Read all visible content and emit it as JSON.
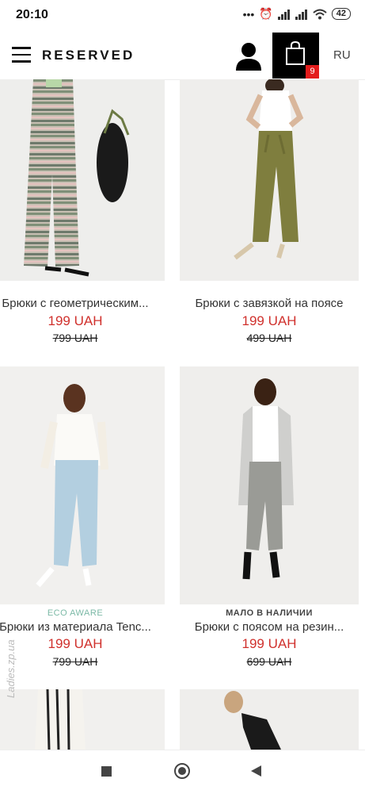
{
  "status_bar": {
    "time": "20:10",
    "battery": "42"
  },
  "header": {
    "brand": "RESERVED",
    "cart_count": "9",
    "language": "RU"
  },
  "products": [
    {
      "name": "Брюки с геометрическим...",
      "price": "199 UAH",
      "old_price": "799 UAH",
      "tag": ""
    },
    {
      "name": "Брюки с завязкой на поясе",
      "price": "199 UAH",
      "old_price": "499 UAH",
      "tag": ""
    },
    {
      "name": "Брюки из материала Tenc...",
      "price": "199 UAH",
      "old_price": "799 UAH",
      "tag": "ECO AWARE"
    },
    {
      "name": "Брюки с поясом на резин...",
      "price": "199 UAH",
      "old_price": "699 UAH",
      "tag": "МАЛО В НАЛИЧИИ"
    }
  ],
  "watermark": "Ladies.zp.ua",
  "colors": {
    "accent_red": "#d0312d",
    "eco_green": "#7bb9a6",
    "cart_bg": "#000000",
    "badge": "#e31c1c"
  }
}
